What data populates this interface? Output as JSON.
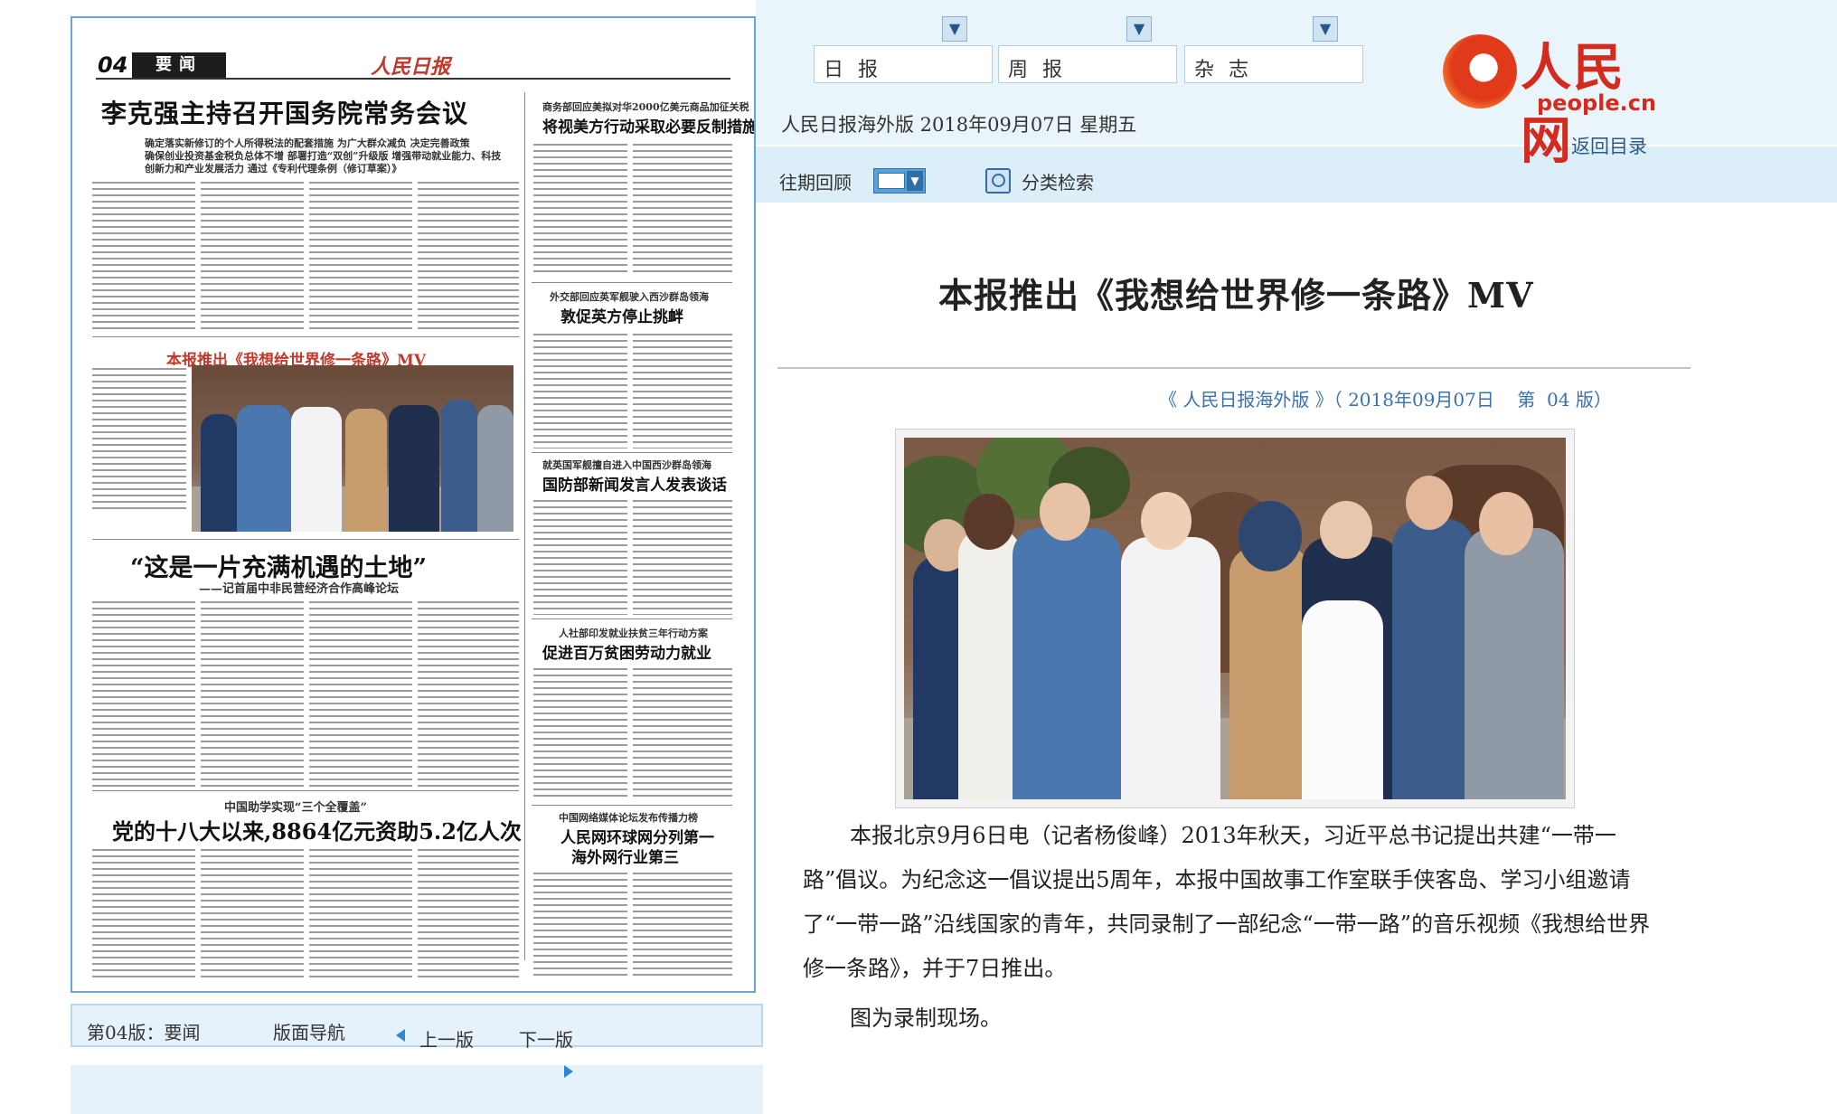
{
  "header": {
    "pub_tabs": [
      "日报",
      "周报",
      "杂志"
    ],
    "logo_cn": "人民网",
    "logo_en": "people.cn",
    "edition_date": "人民日报海外版  2018年09月07日  星期五",
    "back_link": "返回目录",
    "past_review": "往期回顾",
    "category_search": "分类检索"
  },
  "article": {
    "title": "本报推出《我想给世界修一条路》MV",
    "meta": "《 人民日报海外版 》（ 2018年09月07日    第  04 版）",
    "paragraphs": [
      "本报北京9月6日电（记者杨俊峰）2013年秋天，习近平总书记提出共建“一带一路”倡议。为纪念这一倡议提出5周年，本报中国故事工作室联手侠客岛、学习小组邀请了“一带一路”沿线国家的青年，共同录制了一部纪念“一带一路”的音乐视频《我想给世界修一条路》，并于7日推出。",
      "图为录制现场。"
    ]
  },
  "newspaper": {
    "page_no": "04",
    "section": "要闻",
    "masthead": "人民日报",
    "headline_main": "李克强主持召开国务院常务会议",
    "headline_sub1": "确定落实新修订的个人所得税法的配套措施  为广大群众减负  决定完善政策",
    "headline_sub2": "确保创业投资基金税负总体不增  部署打造“双创”升级版  增强带动就业能力、科技",
    "headline_sub3": "创新力和产业发展活力  通过《专利代理条例（修订草案）》",
    "side1_pre": "商务部回应美拟对华2000亿美元商品加征关税",
    "side1": "将视美方行动采取必要反制措施",
    "side2_pre": "外交部回应英军舰驶入西沙群岛领海",
    "side2": "敦促英方停止挑衅",
    "side3_pre": "就英国军舰擅自进入中国西沙群岛领海",
    "side3": "国防部新闻发言人发表谈话",
    "side4_pre": "人社部印发就业扶贫三年行动方案",
    "side4": "促进百万贫困劳动力就业",
    "side5_pre": "中国网络媒体论坛发布传播力榜",
    "side5a": "人民网环球网分列第一",
    "side5b": "海外网行业第三",
    "mv_title": "本报推出《我想给世界修一条路》MV",
    "feature_title": "“这是一片充满机遇的土地”",
    "feature_sub": "——记首届中非民营经济合作高峰论坛",
    "story3_pre": "中国助学实现“三个全覆盖”",
    "story3": "党的十八大以来,8864亿元资助5.2亿人次"
  },
  "pager": {
    "current": "第04版：要闻",
    "nav": "版面导航",
    "prev": "上一版",
    "next": "下一版"
  },
  "colors": {
    "band": "#e9f5fb",
    "band2": "#dceff9",
    "link_blue": "#3a72b0",
    "brand_red": "#d52b1e",
    "paper_border": "#6aa3d8"
  }
}
